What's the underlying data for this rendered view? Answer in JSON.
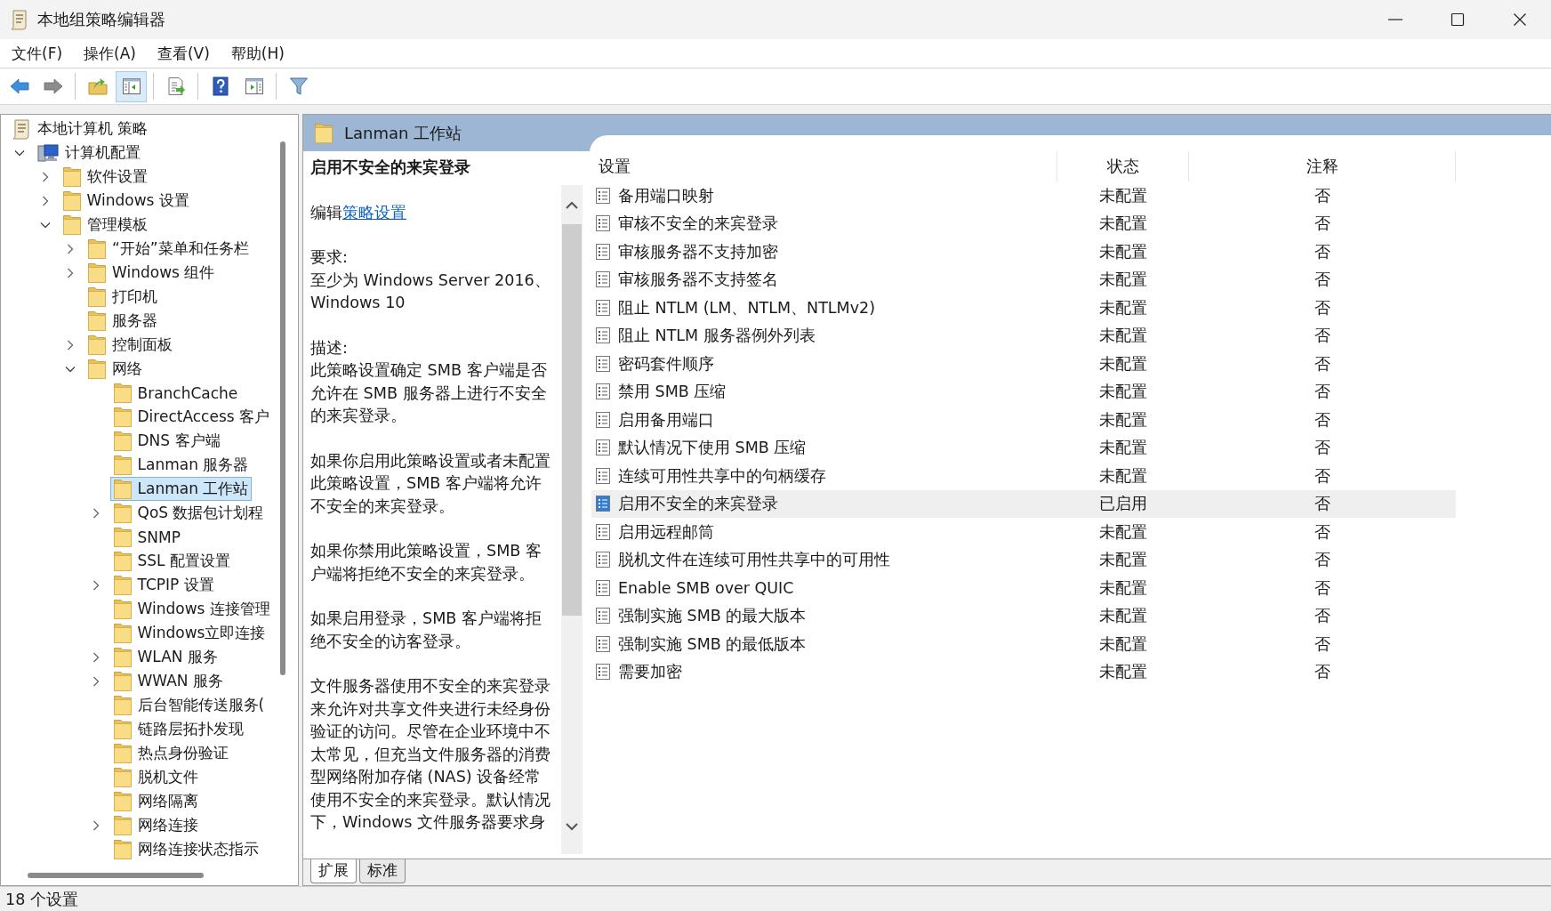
{
  "window": {
    "title": "本地组策略编辑器"
  },
  "menu": [
    "文件(F)",
    "操作(A)",
    "查看(V)",
    "帮助(H)"
  ],
  "toolbar": [
    {
      "kind": "back",
      "pressed": false,
      "disabled": false
    },
    {
      "kind": "forward",
      "pressed": false,
      "disabled": true
    },
    {
      "kind": "separator"
    },
    {
      "kind": "up-folder",
      "pressed": false,
      "disabled": false
    },
    {
      "kind": "console-tree",
      "pressed": true,
      "disabled": false
    },
    {
      "kind": "separator"
    },
    {
      "kind": "export-list",
      "pressed": false,
      "disabled": false
    },
    {
      "kind": "separator"
    },
    {
      "kind": "help",
      "pressed": false,
      "disabled": false
    },
    {
      "kind": "action-pane",
      "pressed": false,
      "disabled": false
    },
    {
      "kind": "separator"
    },
    {
      "kind": "filter",
      "pressed": false,
      "disabled": false
    }
  ],
  "tree_root": {
    "label": "本地计算机 策略",
    "selected": false
  },
  "tree": [
    {
      "label": "计算机配置",
      "kind": "computer",
      "has_children": true,
      "expanded": true,
      "selected": false,
      "children": [
        {
          "label": "软件设置",
          "kind": "folder",
          "has_children": true,
          "expanded": false,
          "selected": false
        },
        {
          "label": "Windows 设置",
          "kind": "folder",
          "has_children": true,
          "expanded": false,
          "selected": false
        },
        {
          "label": "管理模板",
          "kind": "folder",
          "has_children": true,
          "expanded": true,
          "selected": false,
          "children": [
            {
              "label": "“开始”菜单和任务栏",
              "kind": "folder",
              "has_children": true,
              "expanded": false,
              "selected": false
            },
            {
              "label": "Windows 组件",
              "kind": "folder",
              "has_children": true,
              "expanded": false,
              "selected": false
            },
            {
              "label": "打印机",
              "kind": "folder",
              "has_children": false,
              "expanded": false,
              "selected": false
            },
            {
              "label": "服务器",
              "kind": "folder",
              "has_children": false,
              "expanded": false,
              "selected": false
            },
            {
              "label": "控制面板",
              "kind": "folder",
              "has_children": true,
              "expanded": false,
              "selected": false
            },
            {
              "label": "网络",
              "kind": "folder",
              "has_children": true,
              "expanded": true,
              "selected": false,
              "children": [
                {
                  "label": "BranchCache",
                  "kind": "folder",
                  "has_children": false,
                  "expanded": false,
                  "selected": false
                },
                {
                  "label": "DirectAccess 客户",
                  "kind": "folder",
                  "has_children": false,
                  "expanded": false,
                  "selected": false
                },
                {
                  "label": "DNS 客户端",
                  "kind": "folder",
                  "has_children": false,
                  "expanded": false,
                  "selected": false
                },
                {
                  "label": "Lanman 服务器",
                  "kind": "folder",
                  "has_children": false,
                  "expanded": false,
                  "selected": false
                },
                {
                  "label": "Lanman 工作站",
                  "kind": "folder",
                  "has_children": false,
                  "expanded": false,
                  "selected": true
                },
                {
                  "label": "QoS 数据包计划程",
                  "kind": "folder",
                  "has_children": true,
                  "expanded": false,
                  "selected": false
                },
                {
                  "label": "SNMP",
                  "kind": "folder",
                  "has_children": false,
                  "expanded": false,
                  "selected": false
                },
                {
                  "label": "SSL 配置设置",
                  "kind": "folder",
                  "has_children": false,
                  "expanded": false,
                  "selected": false
                },
                {
                  "label": "TCPIP 设置",
                  "kind": "folder",
                  "has_children": true,
                  "expanded": false,
                  "selected": false
                },
                {
                  "label": "Windows 连接管理",
                  "kind": "folder",
                  "has_children": false,
                  "expanded": false,
                  "selected": false
                },
                {
                  "label": "Windows立即连接",
                  "kind": "folder",
                  "has_children": false,
                  "expanded": false,
                  "selected": false
                },
                {
                  "label": "WLAN 服务",
                  "kind": "folder",
                  "has_children": true,
                  "expanded": false,
                  "selected": false
                },
                {
                  "label": "WWAN 服务",
                  "kind": "folder",
                  "has_children": true,
                  "expanded": false,
                  "selected": false
                },
                {
                  "label": "后台智能传送服务(",
                  "kind": "folder",
                  "has_children": false,
                  "expanded": false,
                  "selected": false
                },
                {
                  "label": "链路层拓扑发现",
                  "kind": "folder",
                  "has_children": false,
                  "expanded": false,
                  "selected": false
                },
                {
                  "label": "热点身份验证",
                  "kind": "folder",
                  "has_children": false,
                  "expanded": false,
                  "selected": false
                },
                {
                  "label": "脱机文件",
                  "kind": "folder",
                  "has_children": false,
                  "expanded": false,
                  "selected": false
                },
                {
                  "label": "网络隔离",
                  "kind": "folder",
                  "has_children": false,
                  "expanded": false,
                  "selected": false
                },
                {
                  "label": "网络连接",
                  "kind": "folder",
                  "has_children": true,
                  "expanded": false,
                  "selected": false
                },
                {
                  "label": "网络连接状态指示",
                  "kind": "folder",
                  "has_children": false,
                  "expanded": false,
                  "selected": false
                }
              ]
            }
          ]
        }
      ]
    }
  ],
  "pane_title": "Lanman 工作站",
  "description": {
    "title": "启用不安全的来宾登录",
    "edit_prefix": "编辑",
    "edit_link": "策略设置",
    "sections": [
      {
        "label": "要求:",
        "text": "至少为 Windows Server 2016、Windows 10"
      },
      {
        "label": "描述:",
        "text": "此策略设置确定 SMB 客户端是否允许在 SMB 服务器上进行不安全的来宾登录。"
      },
      {
        "text": "如果你启用此策略设置或者未配置此策略设置，SMB 客户端将允许不安全的来宾登录。"
      },
      {
        "text": "如果你禁用此策略设置，SMB 客户端将拒绝不安全的来宾登录。"
      },
      {
        "text": "如果启用登录，SMB 客户端将拒绝不安全的访客登录。"
      },
      {
        "text": "文件服务器使用不安全的来宾登录来允许对共享文件夹进行未经身份验证的访问。尽管在企业环境中不太常见，但充当文件服务器的消费型网络附加存储 (NAS) 设备经常使用不安全的来宾登录。默认情况下，Windows 文件服务器要求身"
      }
    ]
  },
  "table": {
    "columns": [
      "设置",
      "状态",
      "注释"
    ],
    "rows": [
      {
        "name": "备用端口映射",
        "state": "未配置",
        "comment": "否",
        "selected": false
      },
      {
        "name": "审核不安全的来宾登录",
        "state": "未配置",
        "comment": "否",
        "selected": false
      },
      {
        "name": "审核服务器不支持加密",
        "state": "未配置",
        "comment": "否",
        "selected": false
      },
      {
        "name": "审核服务器不支持签名",
        "state": "未配置",
        "comment": "否",
        "selected": false
      },
      {
        "name": "阻止 NTLM (LM、NTLM、NTLMv2)",
        "state": "未配置",
        "comment": "否",
        "selected": false
      },
      {
        "name": "阻止 NTLM 服务器例外列表",
        "state": "未配置",
        "comment": "否",
        "selected": false
      },
      {
        "name": "密码套件顺序",
        "state": "未配置",
        "comment": "否",
        "selected": false
      },
      {
        "name": "禁用 SMB 压缩",
        "state": "未配置",
        "comment": "否",
        "selected": false
      },
      {
        "name": "启用备用端口",
        "state": "未配置",
        "comment": "否",
        "selected": false
      },
      {
        "name": "默认情况下使用 SMB 压缩",
        "state": "未配置",
        "comment": "否",
        "selected": false
      },
      {
        "name": "连续可用性共享中的句柄缓存",
        "state": "未配置",
        "comment": "否",
        "selected": false
      },
      {
        "name": "启用不安全的来宾登录",
        "state": "已启用",
        "comment": "否",
        "selected": true
      },
      {
        "name": "启用远程邮筒",
        "state": "未配置",
        "comment": "否",
        "selected": false
      },
      {
        "name": "脱机文件在连续可用性共享中的可用性",
        "state": "未配置",
        "comment": "否",
        "selected": false
      },
      {
        "name": "Enable SMB over QUIC",
        "state": "未配置",
        "comment": "否",
        "selected": false
      },
      {
        "name": "强制实施 SMB 的最大版本",
        "state": "未配置",
        "comment": "否",
        "selected": false
      },
      {
        "name": "强制实施 SMB 的最低版本",
        "state": "未配置",
        "comment": "否",
        "selected": false
      },
      {
        "name": "需要加密",
        "state": "未配置",
        "comment": "否",
        "selected": false
      }
    ]
  },
  "view_tabs": [
    {
      "label": "扩展",
      "selected": true
    },
    {
      "label": "标准",
      "selected": false
    }
  ],
  "status_bar": "18 个设置"
}
